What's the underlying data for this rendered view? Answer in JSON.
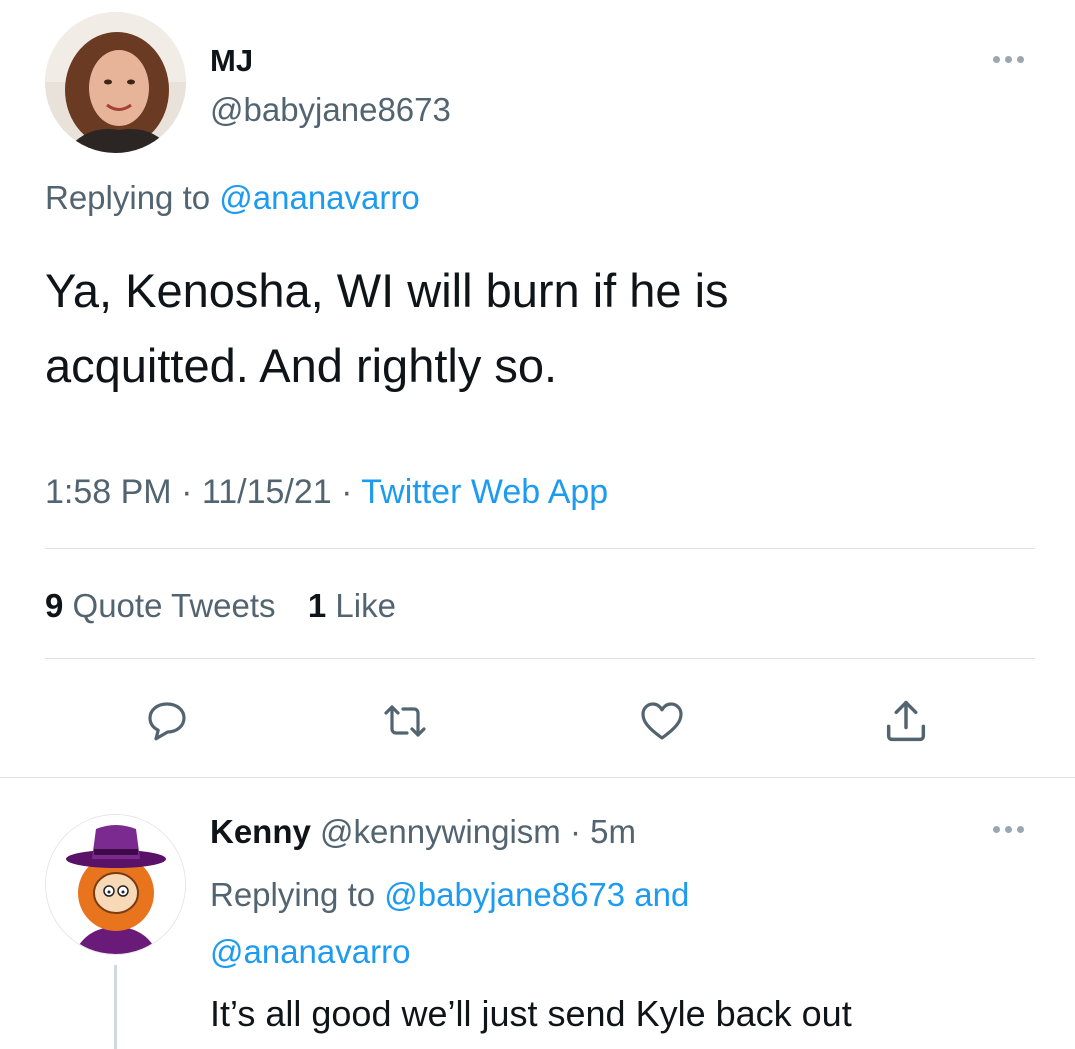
{
  "main_tweet": {
    "author": {
      "display_name": "MJ",
      "handle": "@babyjane8673"
    },
    "replying_prefix": "Replying to ",
    "replying_handle": "@ananavarro",
    "text_line1": "Ya, Kenosha, WI will burn if he is",
    "text_line2": "acquitted. And rightly so.",
    "time": "1:58 PM",
    "separator": " · ",
    "date": "11/15/21",
    "source": "Twitter Web App",
    "stats": {
      "quote_count": "9",
      "quote_label": " Quote Tweets",
      "like_count": "1",
      "like_label": " Like"
    },
    "actions": [
      "reply-icon",
      "retweet-icon",
      "like-icon",
      "share-icon"
    ]
  },
  "reply_tweet": {
    "author": {
      "display_name": "Kenny",
      "handle": "@kennywingism",
      "age": "5m"
    },
    "separator": " · ",
    "replying_prefix": "Replying to ",
    "replying_handle1": "@babyjane8673",
    "replying_and": " and",
    "replying_handle2": "@ananavarro",
    "text": "It’s all good we’ll just send Kyle back out"
  },
  "colors": {
    "link": "#1d9bf0",
    "muted": "#536471",
    "text": "#0f1419",
    "divider": "#dfe3e6"
  }
}
